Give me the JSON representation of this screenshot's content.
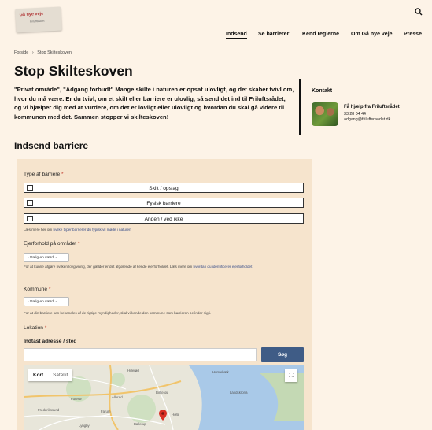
{
  "logo": {
    "text": "Gå nye veje",
    "subtext": "Friluftsrådet"
  },
  "nav": [
    {
      "label": "Indsend",
      "active": true
    },
    {
      "label": "Se barrierer",
      "active": false
    },
    {
      "label": "Kend reglerne",
      "active": false
    },
    {
      "label": "Om Gå nye veje",
      "active": false
    },
    {
      "label": "Presse",
      "active": false
    }
  ],
  "breadcrumb": {
    "home": "Forside",
    "sep": "›",
    "current": "Stop Skilteskoven"
  },
  "page": {
    "title": "Stop Skilteskoven",
    "intro": "\"Privat område\", \"Adgang forbudt\" Mange skilte i naturen er opsat ulovligt, og det skaber tvivl om, hvor du må være. Er du tvivl, om et skilt eller barriere er ulovlig, så send det ind til Friluftsrådet, og vi hjælper dig med at vurdere, om det er lovligt eller ulovligt og hvordan du skal gå videre til kommunen med det. Sammen stopper vi skilteskoven!",
    "section_title": "Indsend barriere"
  },
  "contact": {
    "heading": "Kontakt",
    "name": "Få hjælp fra Friluftsrådet",
    "phone": "33 28 04 44",
    "email": "adgang@friluftsraadet.dk"
  },
  "form": {
    "type_label": "Type af barriere",
    "required_mark": "*",
    "options": [
      "Skilt / opslag",
      "Fysisk barriere",
      "Anden / ved ikke"
    ],
    "type_help_prefix": "Læs mere her om",
    "type_help_link": "hvilke typer barrierer du typisk vil møde i naturen",
    "owner_label": "Ejerforhold på området",
    "owner_select": "- Vælg en værdi -",
    "owner_help": "For at kunne afgøre hvilken lovgivning, der gælder er det afgørende af kende ejerforholdet. Læs mere om",
    "owner_help_link": "hvordan du identificerer ejerforholdet",
    "kommune_label": "Kommune",
    "kommune_select": "- Vælg en værdi -",
    "kommune_help": "For at din barriere kan behandles af de rigtige myndigheder, skal vi kende den kommune som barrieren befinder sig i.",
    "location_label": "Lokation",
    "address_label": "Indtast adresse / sted",
    "address_value": "",
    "search_button": "Søg"
  },
  "map": {
    "tabs": [
      "Kort",
      "Satellit"
    ],
    "active_tab": "Kort",
    "fullscreen_icon": "fullscreen-icon",
    "places": [
      "Hillerød",
      "Allerød",
      "Birkerød",
      "Farum",
      "Holte",
      "Frederikssund",
      "Ballerup",
      "Lyngby",
      "Humlebæk",
      "Landskrona",
      "Furesø"
    ]
  },
  "colors": {
    "background": "#fdf3e7",
    "form_bg": "#f6e4cd",
    "button": "#3f5c86",
    "required": "#c0392b",
    "marker": "#d93025"
  }
}
